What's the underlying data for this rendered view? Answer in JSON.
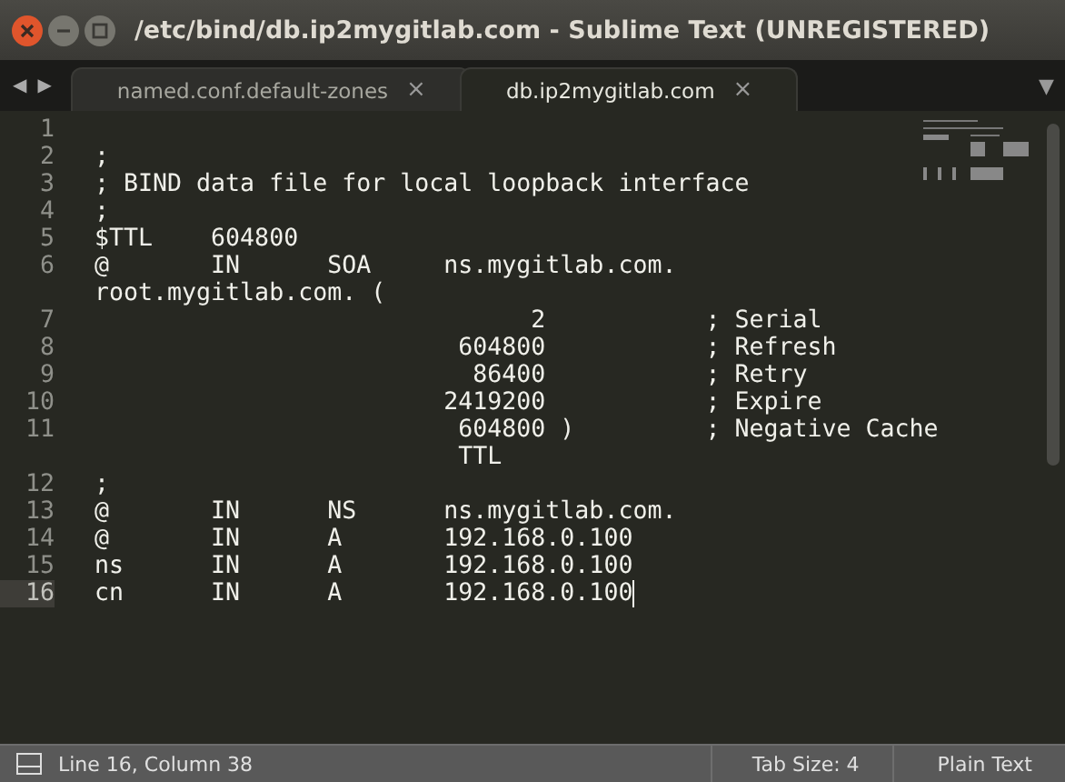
{
  "window": {
    "title": "/etc/bind/db.ip2mygitlab.com - Sublime Text (UNREGISTERED)"
  },
  "tab_nav": [
    "◀",
    "▶"
  ],
  "tabs": [
    {
      "label": "named.conf.default-zones",
      "close": "×",
      "selected": false
    },
    {
      "label": "db.ip2mygitlab.com",
      "close": "×",
      "selected": true
    }
  ],
  "tab_menu": "▼",
  "lines": [
    {
      "number": "1",
      "rows": [
        ""
      ],
      "current": false
    },
    {
      "number": "2",
      "rows": [
        ";"
      ],
      "current": false
    },
    {
      "number": "3",
      "rows": [
        "; BIND data file for local loopback interface"
      ],
      "current": false
    },
    {
      "number": "4",
      "rows": [
        ";"
      ],
      "current": false
    },
    {
      "number": "5",
      "rows": [
        "$TTL    604800"
      ],
      "current": false
    },
    {
      "number": "6",
      "rows": [
        "@       IN      SOA     ns.mygitlab.com.",
        "root.mygitlab.com. ("
      ],
      "current": false
    },
    {
      "number": "7",
      "rows": [
        "                              2           ; Serial"
      ],
      "current": false
    },
    {
      "number": "8",
      "rows": [
        "                         604800           ; Refresh"
      ],
      "current": false
    },
    {
      "number": "9",
      "rows": [
        "                          86400           ; Retry"
      ],
      "current": false
    },
    {
      "number": "10",
      "rows": [
        "                        2419200           ; Expire"
      ],
      "current": false
    },
    {
      "number": "11",
      "rows": [
        "                         604800 )         ; Negative Cache",
        "                         TTL"
      ],
      "current": false
    },
    {
      "number": "12",
      "rows": [
        ";"
      ],
      "current": false
    },
    {
      "number": "13",
      "rows": [
        "@       IN      NS      ns.mygitlab.com."
      ],
      "current": false
    },
    {
      "number": "14",
      "rows": [
        "@       IN      A       192.168.0.100"
      ],
      "current": false
    },
    {
      "number": "15",
      "rows": [
        "ns      IN      A       192.168.0.100"
      ],
      "current": false
    },
    {
      "number": "16",
      "rows": [
        "cn      IN      A       192.168.0.100"
      ],
      "current": true
    }
  ],
  "status_bar": {
    "position": "Line 16, Column 38",
    "tab_size": "Tab Size: 4",
    "syntax": "Plain Text"
  }
}
